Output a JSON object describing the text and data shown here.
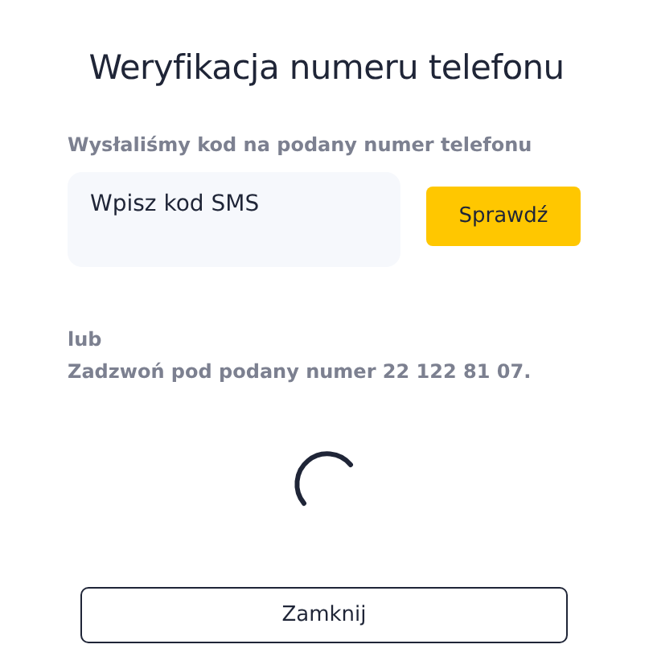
{
  "title": "Weryfikacja numeru telefonu",
  "code_label": "Wysłaliśmy kod na podany numer telefonu",
  "code_field": {
    "placeholder": "Wpisz kod SMS"
  },
  "check_button": "Sprawdź",
  "alternative": [
    "lub",
    "Zadzwoń pod podany numer 22 122 81 07."
  ],
  "close_button": "Zamknij"
}
